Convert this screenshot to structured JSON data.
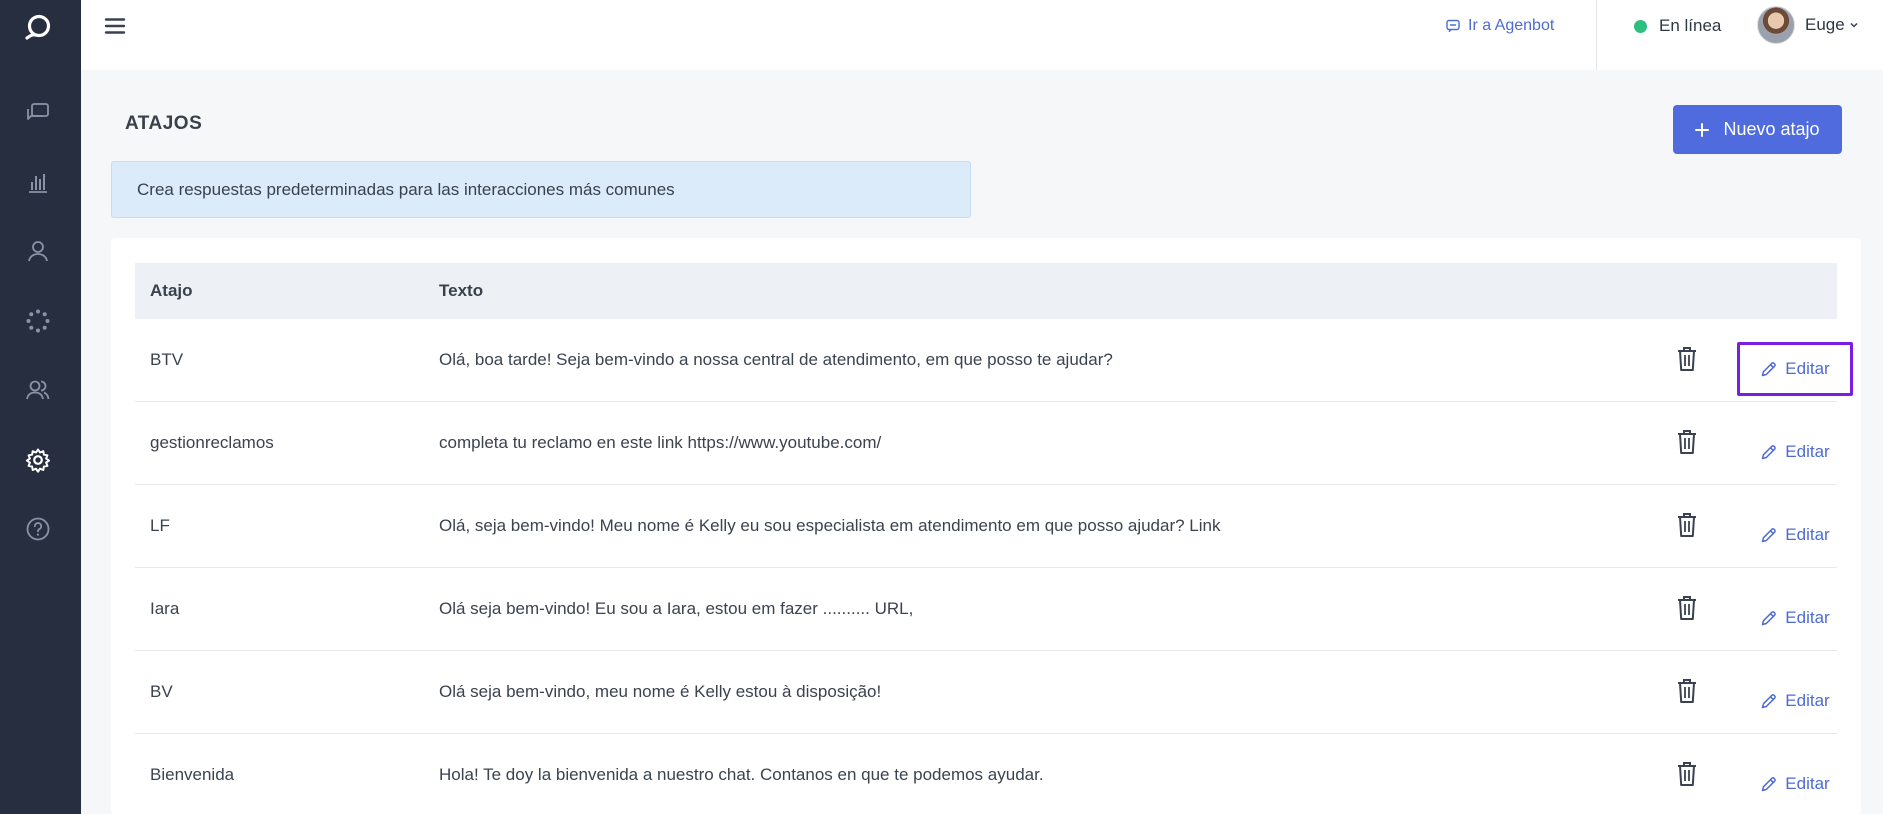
{
  "topbar": {
    "agenbot_link": "Ir a Agenbot",
    "status": "En línea",
    "user_name": "Euge"
  },
  "page": {
    "title": "ATAJOS",
    "new_button": "Nuevo atajo",
    "info": "Crea respuestas predeterminadas para las interacciones más comunes"
  },
  "table": {
    "headers": {
      "shortcut": "Atajo",
      "text": "Texto"
    },
    "edit_label": "Editar",
    "rows": [
      {
        "shortcut": "BTV",
        "text": "Olá, boa tarde! Seja bem-vindo a nossa central de atendimento, em que posso te ajudar?"
      },
      {
        "shortcut": "gestionreclamos",
        "text": "completa tu reclamo en este link https://www.youtube.com/"
      },
      {
        "shortcut": "LF",
        "text": "Olá, seja bem-vindo! Meu nome é Kelly eu sou especialista em atendimento em que posso ajudar? Link"
      },
      {
        "shortcut": "Iara",
        "text": "Olá seja bem-vindo! Eu sou a Iara, estou em fazer .......... URL,"
      },
      {
        "shortcut": "BV",
        "text": "Olá seja bem-vindo, meu nome é Kelly estou à disposição!"
      },
      {
        "shortcut": "Bienvenida",
        "text": "Hola! Te doy la bienvenida a nuestro chat. Contanos en que te podemos ayudar."
      }
    ]
  },
  "colors": {
    "sidebar": "#272e3f",
    "accent": "#4f6bde",
    "online": "#2dbf7f",
    "highlight_border": "#7b1ee3"
  },
  "icons": {
    "sidebar": [
      "conversations-icon",
      "reports-icon",
      "contacts-icon",
      "loading-dots-icon",
      "team-icon",
      "gear-icon",
      "help-icon"
    ]
  }
}
